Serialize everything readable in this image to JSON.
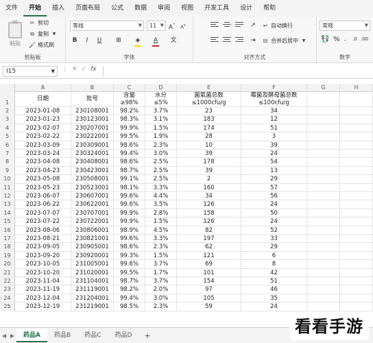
{
  "menu": {
    "tabs": [
      "文件",
      "开始",
      "插入",
      "页面布局",
      "公式",
      "数据",
      "审阅",
      "视图",
      "开发工具",
      "设计",
      "帮助"
    ],
    "active_index": 1
  },
  "ribbon": {
    "clipboard": {
      "paste": "粘贴",
      "cut": "剪切",
      "copy": "复制",
      "format_painter": "格式刷",
      "label": "剪贴板"
    },
    "font": {
      "name": "等线",
      "size": "11",
      "label": "字体",
      "fill_color": "#ffd400",
      "font_color": "#e02020"
    },
    "alignment": {
      "wrap": "自动换行",
      "merge": "合并后居中",
      "label": "对齐方式"
    },
    "number": {
      "format": "常规",
      "label": "数字"
    }
  },
  "formula_bar": {
    "name_box": "I15",
    "fx": "fx",
    "content": ""
  },
  "columns": [
    "A",
    "B",
    "C",
    "D",
    "E",
    "F",
    "G",
    "H"
  ],
  "header_row": {
    "A": [
      "日期"
    ],
    "B": [
      "批号"
    ],
    "C": [
      "含量",
      "≥98%"
    ],
    "D": [
      "水分",
      "≤5%"
    ],
    "E": [
      "菌氧菌总数",
      "≤1000cfu/g"
    ],
    "F": [
      "霉菌及酵母菌总数",
      "≤100cfu/g"
    ]
  },
  "rows": [
    [
      "2023-01-08",
      "230108001",
      "98.2%",
      "3.7%",
      "23",
      "34"
    ],
    [
      "2023-01-23",
      "230123001",
      "98.3%",
      "3.1%",
      "183",
      "12"
    ],
    [
      "2023-02-07",
      "230207001",
      "99.9%",
      "1.5%",
      "174",
      "51"
    ],
    [
      "2023-02-22",
      "230222001",
      "99.5%",
      "1.9%",
      "28",
      "3"
    ],
    [
      "2023-03-09",
      "230309001",
      "98.6%",
      "2.3%",
      "10",
      "39"
    ],
    [
      "2023-03-24",
      "230324001",
      "99.4%",
      "3.0%",
      "39",
      "24"
    ],
    [
      "2023-04-08",
      "230408001",
      "98.6%",
      "2.5%",
      "178",
      "54"
    ],
    [
      "2023-04-23",
      "230423001",
      "98.7%",
      "2.5%",
      "39",
      "13"
    ],
    [
      "2023-05-08",
      "230508001",
      "99.1%",
      "2.5%",
      "2",
      "29"
    ],
    [
      "2023-05-23",
      "230523001",
      "98.1%",
      "3.3%",
      "160",
      "57"
    ],
    [
      "2023-06-07",
      "230607001",
      "99.6%",
      "4.4%",
      "34",
      "56"
    ],
    [
      "2023-06-22",
      "230622001",
      "99.6%",
      "3.5%",
      "126",
      "24"
    ],
    [
      "2023-07-07",
      "230707001",
      "99.9%",
      "2.8%",
      "158",
      "50"
    ],
    [
      "2023-07-22",
      "230722001",
      "99.9%",
      "1.5%",
      "126",
      "24"
    ],
    [
      "2023-08-06",
      "230806001",
      "98.9%",
      "4.5%",
      "82",
      "52"
    ],
    [
      "2023-08-21",
      "230821001",
      "99.6%",
      "3.3%",
      "197",
      "33"
    ],
    [
      "2023-09-05",
      "230905001",
      "98.6%",
      "2.3%",
      "62",
      "29"
    ],
    [
      "2023-09-20",
      "230920001",
      "99.3%",
      "1.5%",
      "121",
      "6"
    ],
    [
      "2023-10-05",
      "231005001",
      "99.6%",
      "3.7%",
      "69",
      "8"
    ],
    [
      "2023-10-20",
      "231020001",
      "99.5%",
      "1.7%",
      "101",
      "42"
    ],
    [
      "2023-11-04",
      "231104001",
      "98.7%",
      "3.7%",
      "154",
      "51"
    ],
    [
      "2023-11-19",
      "231119001",
      "98.2%",
      "2.0%",
      "97",
      "46"
    ],
    [
      "2023-12-04",
      "231204001",
      "99.4%",
      "3.0%",
      "105",
      "35"
    ],
    [
      "2023-12-19",
      "231219001",
      "98.5%",
      "2.3%",
      "59",
      "24"
    ]
  ],
  "sheets": {
    "tabs": [
      "药品A",
      "药品B",
      "药品C",
      "药品D"
    ],
    "active_index": 0,
    "add": "+"
  },
  "watermark": "看看手游网"
}
